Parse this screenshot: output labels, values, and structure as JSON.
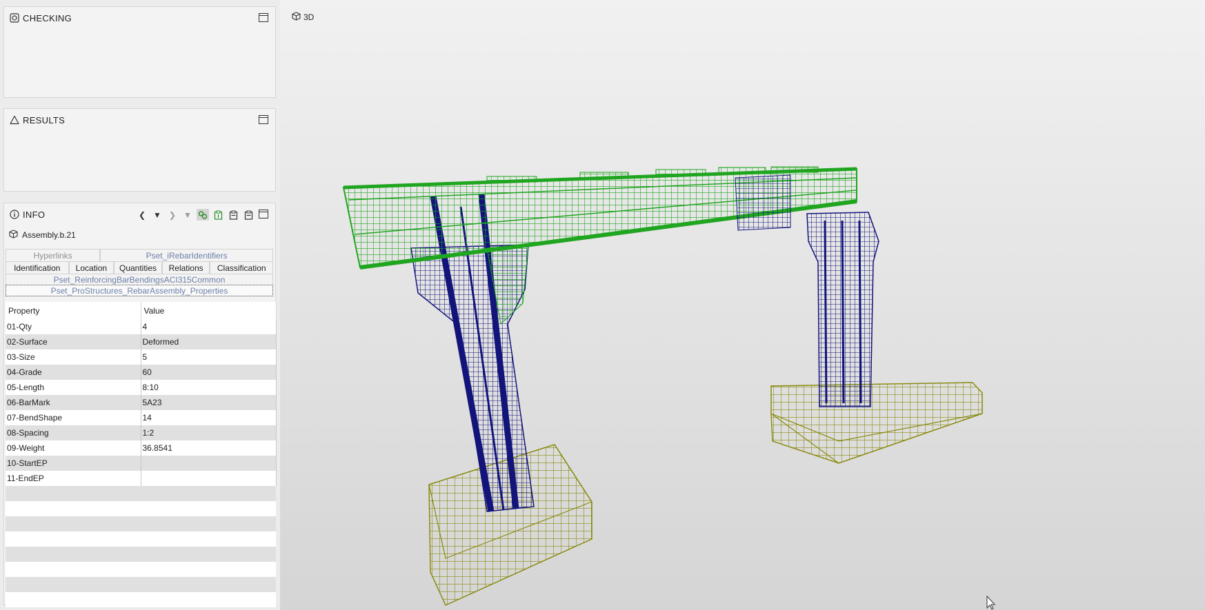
{
  "panels": {
    "checking": {
      "title": "CHECKING"
    },
    "results": {
      "title": "RESULTS"
    },
    "info": {
      "title": "INFO",
      "object_name": "Assembly.b.21",
      "tabs_row1": [
        "Hyperlinks",
        "Pset_iRebarIdentifiers"
      ],
      "tabs_row2": [
        "Identification",
        "Location",
        "Quantities",
        "Relations",
        "Classification"
      ],
      "tab_row3": "Pset_ReinforcingBarBendingsACI315Common",
      "tab_row4": "Pset_ProStructures_RebarAssembly_Properties",
      "table": {
        "headers": [
          "Property",
          "Value"
        ],
        "rows": [
          [
            "01-Qty",
            "4"
          ],
          [
            "02-Surface",
            "Deformed"
          ],
          [
            "03-Size",
            "5"
          ],
          [
            "04-Grade",
            "60"
          ],
          [
            "05-Length",
            "8:10"
          ],
          [
            "06-BarMark",
            "5A23"
          ],
          [
            "07-BendShape",
            "14"
          ],
          [
            "08-Spacing",
            "1:2"
          ],
          [
            "09-Weight",
            "36.8541"
          ],
          [
            "10-StartEP",
            ""
          ],
          [
            "11-EndEP",
            ""
          ]
        ]
      }
    }
  },
  "viewport": {
    "label": "3D"
  },
  "colors": {
    "beam": "#1fa51f",
    "column": "#12147a",
    "footing": "#8a8a10"
  },
  "icons": [
    "checking-icon",
    "results-icon",
    "info-icon",
    "cube-icon",
    "maximize-icon",
    "chevron-left-icon",
    "dropdown-icon",
    "chevron-right-icon",
    "link-icon",
    "clipboard-icon",
    "cursor-icon"
  ]
}
